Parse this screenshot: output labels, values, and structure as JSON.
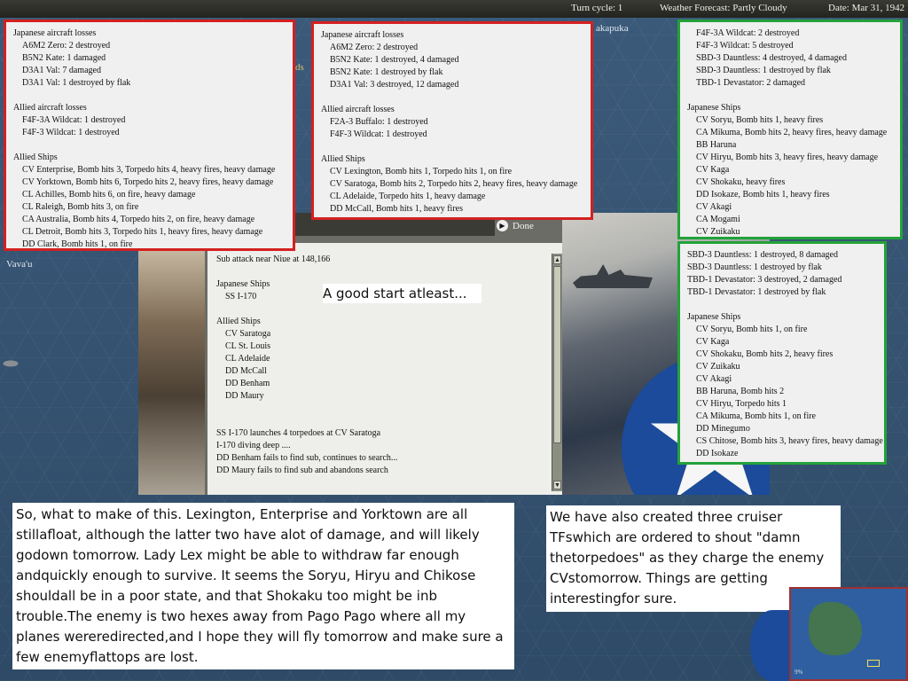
{
  "status_bar": {
    "turn": "Turn cycle: 1",
    "weather": "Weather Forecast: Partly Cloudy",
    "date": "Date: Mar 31, 1942"
  },
  "map_labels": {
    "top_right": "akapuka",
    "left": "Vava'u",
    "ds": "ds"
  },
  "box1": [
    "Japanese aircraft losses",
    "  A6M2 Zero: 2 destroyed",
    "  B5N2 Kate: 1 damaged",
    "  D3A1 Val: 7 damaged",
    "  D3A1 Val: 1 destroyed by flak",
    "",
    "Allied aircraft losses",
    "  F4F-3A Wildcat: 1 destroyed",
    "  F4F-3 Wildcat: 1 destroyed",
    "",
    "Allied Ships",
    "  CV Enterprise, Bomb hits 3, Torpedo hits 4,  heavy fires,  heavy damage",
    "  CV Yorktown, Bomb hits 6, Torpedo hits 2, heavy fires,  heavy damage",
    "  CL Achilles, Bomb hits 6, on fire,  heavy damage",
    "  CL Raleigh, Bomb hits 3, on fire",
    "  CA Australia, Bomb hits 4, Torpedo hits 2, on fire,  heavy damage",
    "  CL Detroit, Bomb hits 3, Torpedo hits 1, heavy fires,  heavy damage",
    "  DD Clark, Bomb hits 1, on fire"
  ],
  "box2": [
    "Japanese aircraft losses",
    "  A6M2 Zero: 2 destroyed",
    "  B5N2 Kate: 1 destroyed, 4 damaged",
    "  B5N2 Kate: 1 destroyed by flak",
    "  D3A1 Val: 3 destroyed, 12 damaged",
    "",
    "Allied aircraft losses",
    "  F2A-3 Buffalo: 1 destroyed",
    "  F4F-3 Wildcat: 1 destroyed",
    "",
    "Allied Ships",
    "  CV Lexington, Bomb hits 1, Torpedo hits 1,  on fire",
    "  CV Saratoga, Bomb hits 2, Torpedo hits 2,  heavy fires,  heavy damage",
    "  CL Adelaide, Torpedo hits 1,  heavy damage",
    "  DD McCall, Bomb hits 1,  heavy fires"
  ],
  "box3": [
    "  F4F-3A Wildcat: 2 destroyed",
    "  F4F-3 Wildcat: 5 destroyed",
    "  SBD-3 Dauntless: 4 destroyed, 4 damaged",
    "  SBD-3 Dauntless: 1 destroyed by flak",
    "  TBD-1 Devastator: 2 damaged",
    "",
    "Japanese Ships",
    "  CV Soryu, Bomb hits 1,  heavy fires",
    "  CA Mikuma, Bomb hits 2,  heavy fires,  heavy damage",
    "  BB Haruna",
    "  CV Hiryu, Bomb hits 3,  heavy fires,  heavy damage",
    "  CV Kaga",
    "  CV Shokaku,  heavy fires",
    "  DD Isokaze, Bomb hits 1,  heavy fires",
    "  CV Akagi",
    "  CA Mogami",
    "  CV Zuikaku"
  ],
  "box4": [
    "SBD-3 Dauntless: 1 destroyed, 8 damaged",
    "SBD-3 Dauntless: 1 destroyed by flak",
    "TBD-1 Devastator: 3 destroyed, 2 damaged",
    "TBD-1 Devastator: 1 destroyed by flak",
    "",
    "Japanese Ships",
    "  CV Soryu, Bomb hits 1,  on fire",
    "  CV Kaga",
    "  CV Shokaku, Bomb hits 2,  heavy fires",
    "  CV Zuikaku",
    "  CV Akagi",
    "  BB Haruna, Bomb hits 2",
    "  CV Hiryu, Torpedo hits 1",
    "  CA Mikuma, Bomb hits 1,  on fire",
    "  DD Minegumo",
    "  CS Chitose, Bomb hits 3,  heavy fires,  heavy damage",
    "  DD Isokaze"
  ],
  "combat_report": [
    "Sub attack near Niue  at 148,166",
    "",
    "Japanese Ships",
    "  SS I-170",
    "",
    "Allied Ships",
    "  CV Saratoga",
    "  CL St. Louis",
    "  CL Adelaide",
    "  DD McCall",
    "  DD Benham",
    "  DD Maury",
    "",
    "",
    "SS I-170 launches 4 torpedoes at CV Saratoga",
    "I-170 diving deep ....",
    "DD Benham fails to find sub, continues to search...",
    "DD Maury fails to find sub and abandons search"
  ],
  "done_label": "Done",
  "caption_mid": "A good start atleast...",
  "comment_left": [
    "So, what to make of this. Lexington, Enterprise and Yorktown are all still",
    "afloat, although the latter two have alot of damage, and will likely go",
    "down tomorrow. Lady Lex might be able to withdraw far enough and",
    "quickly enough to survive. It seems the Soryu, Hiryu and Chikose should",
    "all be in a poor state, and that Shokaku too might be inb trouble.",
    "The enemy is two hexes away from Pago Pago where all my planes were",
    "redirected,and I hope they will fly tomorrow and make sure a few enemy",
    "flattops are lost."
  ],
  "comment_right": [
    "We have also created three cruiser TFs",
    "which are ordered to shout \"damn the",
    "torpedoes\" as they charge the enemy CVs",
    "tomorrow. Things are getting interesting",
    "for sure."
  ],
  "minimap_zoom": "9%",
  "icons": {
    "done": "arrow-circle-icon",
    "scroll_up": "triangle-up",
    "scroll_down": "triangle-down"
  },
  "colors": {
    "red_border": "#d42020",
    "green_border": "#23a23a"
  }
}
